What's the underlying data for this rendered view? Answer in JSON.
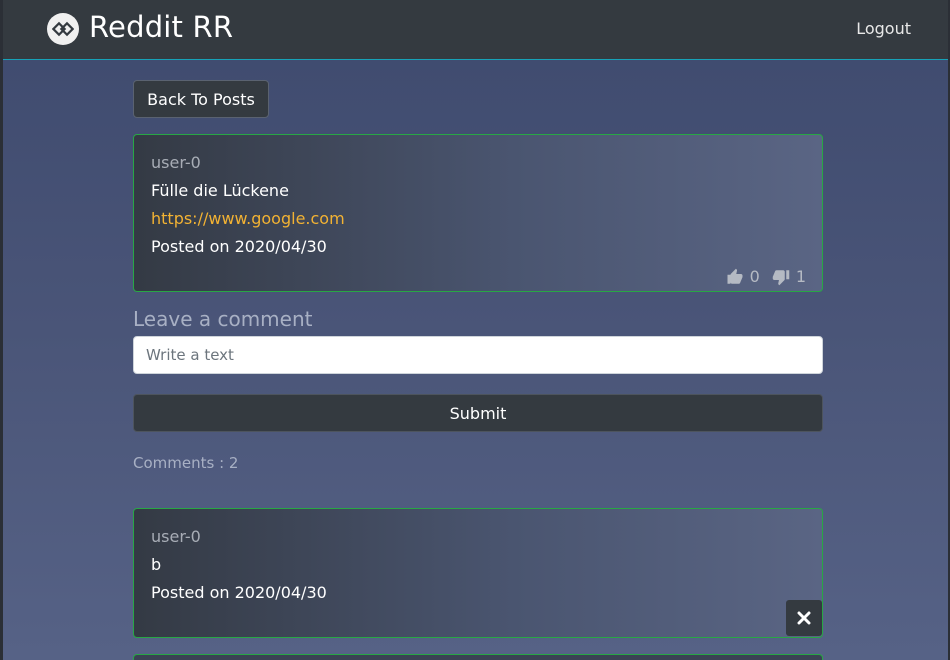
{
  "navbar": {
    "brand": "Reddit RR",
    "logout_label": "Logout"
  },
  "back_button_label": "Back To Posts",
  "post": {
    "author": "user-0",
    "title": "Fülle die Lückene",
    "link": "https://www.google.com",
    "posted": "Posted on 2020/04/30",
    "upvotes": "0",
    "downvotes": "1"
  },
  "comment_form": {
    "label": "Leave a comment",
    "placeholder": "Write a text",
    "submit_label": "Submit"
  },
  "comments_count": "Comments : 2",
  "comments": [
    {
      "author": "user-0",
      "text": "b",
      "posted": "Posted on 2020/04/30"
    }
  ],
  "colors": {
    "navbar": "#343a40",
    "card_border": "#28a745",
    "link": "#f2b233",
    "button": "#343a40"
  },
  "icons": [
    "brand-logo-icon",
    "thumbs-up-icon",
    "thumbs-down-icon",
    "close-icon"
  ]
}
